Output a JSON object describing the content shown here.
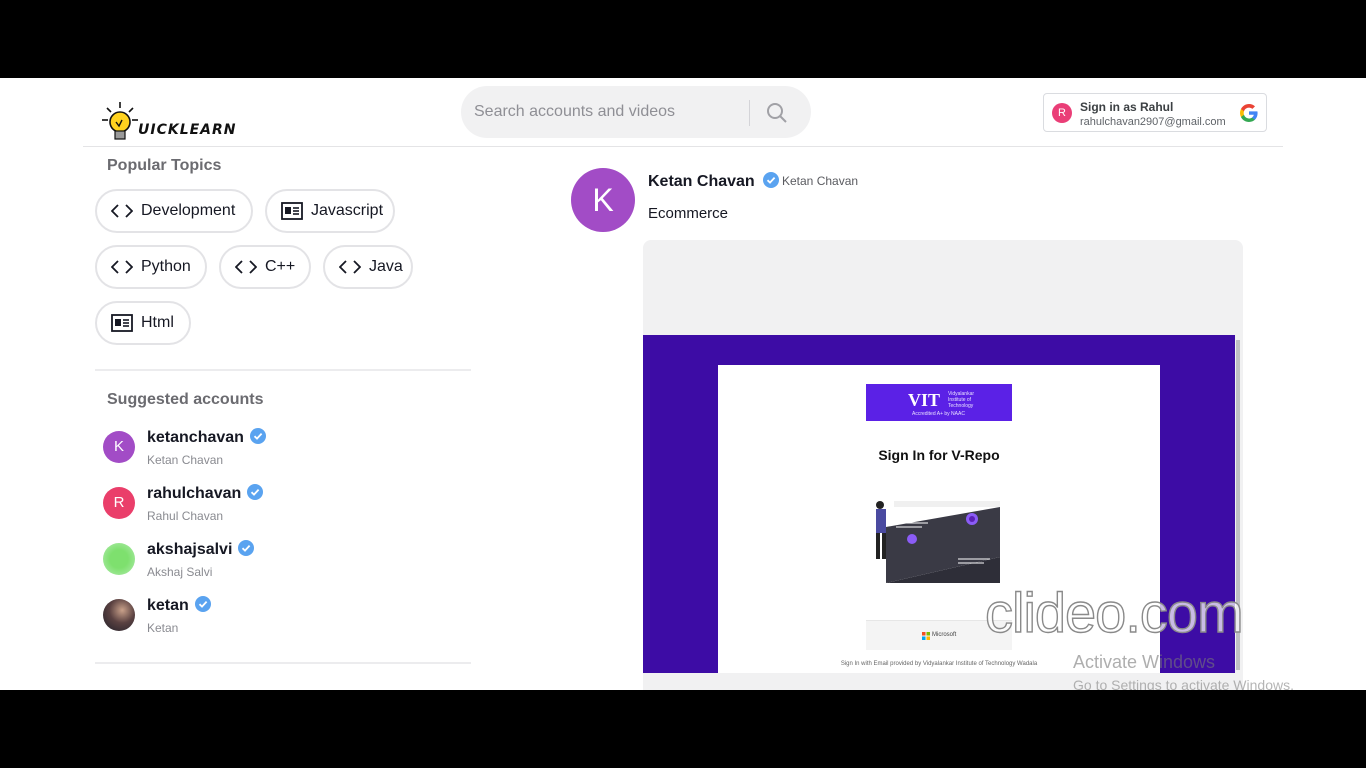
{
  "brand": {
    "logo_text": "UICKLEARN"
  },
  "search": {
    "placeholder": "Search accounts and videos"
  },
  "google_signin": {
    "initial": "R",
    "title": "Sign in as Rahul",
    "email": "rahulchavan2907@gmail.com"
  },
  "sidebar": {
    "popular_title": "Popular Topics",
    "topics": [
      {
        "label": "Development",
        "icon": "code-icon"
      },
      {
        "label": "Javascript",
        "icon": "news-icon"
      },
      {
        "label": "Python",
        "icon": "code-icon"
      },
      {
        "label": "C++",
        "icon": "code-icon"
      },
      {
        "label": "Java",
        "icon": "code-icon"
      },
      {
        "label": "Html",
        "icon": "news-icon"
      }
    ],
    "suggested_title": "Suggested accounts",
    "accounts": [
      {
        "username": "ketanchavan",
        "name": "Ketan Chavan",
        "initial": "K",
        "color": "#a24cc6"
      },
      {
        "username": "rahulchavan",
        "name": "Rahul Chavan",
        "initial": "R",
        "color": "#ea3e6a"
      },
      {
        "username": "akshajsalvi",
        "name": "Akshaj Salvi",
        "initial": "",
        "color": "#8ee08a"
      },
      {
        "username": "ketan",
        "name": "Ketan",
        "initial": "",
        "color": "#4a3a3a"
      }
    ]
  },
  "post": {
    "initial": "K",
    "username": "Ketan Chavan",
    "nickname": "Ketan Chavan",
    "caption": "Ecommerce",
    "video": {
      "banner_title": "VIT",
      "banner_subtitle": "Vidyalankar Institute of Technology",
      "banner_accreditation": "Accredited A+ by NAAC",
      "heading": "Sign In for V-Repo",
      "ms_button": "Microsoft",
      "footer": "Sign In with Email provided by Vidyalankar Institute of Technology Wadala"
    }
  },
  "overlay": {
    "watermark": "clideo.com",
    "activate_title": "Activate Windows",
    "activate_sub": "Go to Settings to activate Windows."
  },
  "colors": {
    "accent": "#3d0ca5",
    "verified": "#20d5ec"
  }
}
